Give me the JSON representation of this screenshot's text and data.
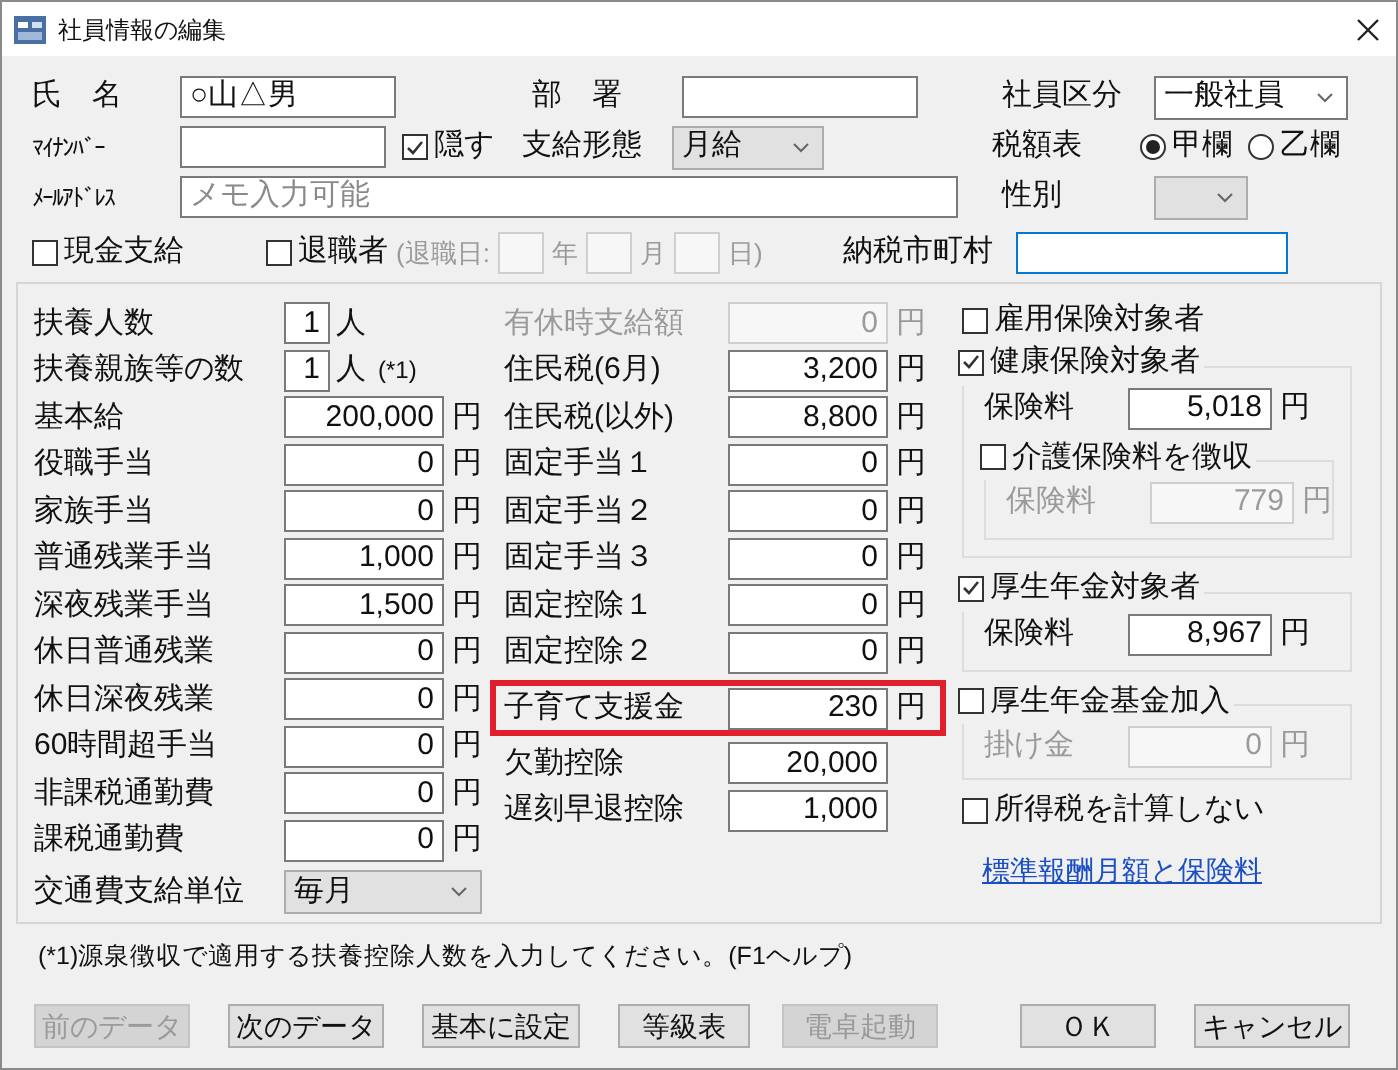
{
  "window": {
    "title": "社員情報の編集"
  },
  "top": {
    "name": {
      "label": "氏　名",
      "value": "○山△男"
    },
    "department": {
      "label": "部　署"
    },
    "employee_type": {
      "label": "社員区分",
      "value": "一般社員",
      "editable": true
    },
    "my_number": {
      "label": "ﾏｲﾅﾝﾊﾞｰ"
    },
    "hide": {
      "label": "隠す",
      "checked": true
    },
    "pay_type": {
      "label": "支給形態",
      "value": "月給",
      "editable": false
    },
    "tax_table": {
      "label": "税額表",
      "options": [
        {
          "label": "甲欄",
          "selected": true
        },
        {
          "label": "乙欄",
          "selected": false
        }
      ]
    },
    "email": {
      "label": "ﾒｰﾙｱﾄﾞﾚｽ",
      "placeholder": "メモ入力可能"
    },
    "gender": {
      "label": "性別",
      "editable": false
    },
    "cash_payment": {
      "label": "現金支給",
      "checked": false
    },
    "retired": {
      "label": "退職者",
      "checked": false
    },
    "retire_date": {
      "open": "(退職日:",
      "year": "年",
      "month": "月",
      "close": "日)"
    },
    "municipality": {
      "label": "納税市町村",
      "focused": true
    }
  },
  "left_rows": [
    {
      "kind": "count",
      "label": "扶養人数",
      "value": "1",
      "unit": "人"
    },
    {
      "kind": "count",
      "label": "扶養親族等の数",
      "value": "1",
      "unit": "人",
      "note": "(*1)"
    },
    {
      "kind": "amount",
      "label": "基本給",
      "value": "200,000",
      "unit": "円"
    },
    {
      "kind": "amount",
      "label": "役職手当",
      "value": "0",
      "unit": "円"
    },
    {
      "kind": "amount",
      "label": "家族手当",
      "value": "0",
      "unit": "円"
    },
    {
      "kind": "amount",
      "label": "普通残業手当",
      "value": "1,000",
      "unit": "円"
    },
    {
      "kind": "amount",
      "label": "深夜残業手当",
      "value": "1,500",
      "unit": "円"
    },
    {
      "kind": "amount",
      "label": "休日普通残業",
      "value": "0",
      "unit": "円"
    },
    {
      "kind": "amount",
      "label": "休日深夜残業",
      "value": "0",
      "unit": "円"
    },
    {
      "kind": "amount",
      "label": "60時間超手当",
      "value": "0",
      "unit": "円"
    },
    {
      "kind": "amount",
      "label": "非課税通勤費",
      "value": "0",
      "unit": "円"
    },
    {
      "kind": "amount",
      "label": "課税通勤費",
      "value": "0",
      "unit": "円"
    },
    {
      "kind": "select",
      "label": "交通費支給単位",
      "value": "毎月"
    }
  ],
  "middle_rows": [
    {
      "label": "有休時支給額",
      "value": "0",
      "unit": "円",
      "disabled": true,
      "highlighted": false
    },
    {
      "label": "住民税(6月)",
      "value": "3,200",
      "unit": "円",
      "disabled": false,
      "highlighted": false
    },
    {
      "label": "住民税(以外)",
      "value": "8,800",
      "unit": "円",
      "disabled": false,
      "highlighted": false
    },
    {
      "label": "固定手当１",
      "value": "0",
      "unit": "円",
      "disabled": false,
      "highlighted": false
    },
    {
      "label": "固定手当２",
      "value": "0",
      "unit": "円",
      "disabled": false,
      "highlighted": false
    },
    {
      "label": "固定手当３",
      "value": "0",
      "unit": "円",
      "disabled": false,
      "highlighted": false
    },
    {
      "label": "固定控除１",
      "value": "0",
      "unit": "円",
      "disabled": false,
      "highlighted": false
    },
    {
      "label": "固定控除２",
      "value": "0",
      "unit": "円",
      "disabled": false,
      "highlighted": false
    },
    {
      "label": "子育て支援金",
      "value": "230",
      "unit": "円",
      "disabled": false,
      "highlighted": true
    },
    {
      "label": "欠勤控除",
      "value": "20,000",
      "disabled": false,
      "highlighted": false
    },
    {
      "label": "遅刻早退控除",
      "value": "1,000",
      "disabled": false,
      "highlighted": false
    }
  ],
  "insurance": {
    "employment": {
      "label": "雇用保険対象者",
      "checked": false
    },
    "health": {
      "label": "健康保険対象者",
      "checked": true,
      "fee_label": "保険料",
      "fee": "5,018",
      "unit": "円",
      "care": {
        "label": "介護保険料を徴収",
        "checked": false,
        "fee_label": "保険料",
        "fee": "779",
        "unit": "円"
      }
    },
    "pension": {
      "label": "厚生年金対象者",
      "checked": true,
      "fee_label": "保険料",
      "fee": "8,967",
      "unit": "円"
    },
    "pension_fund": {
      "label": "厚生年金基金加入",
      "checked": false,
      "fee_label": "掛け金",
      "fee": "0",
      "unit": "円"
    },
    "no_income_tax": {
      "label": "所得税を計算しない",
      "checked": false
    },
    "link": "標準報酬月額と保険料"
  },
  "footnote": "(*1)源泉徴収で適用する扶養控除人数を入力してください。(F1ヘルプ)",
  "buttons": [
    {
      "label": "前のデータ",
      "disabled": true
    },
    {
      "label": "次のデータ",
      "disabled": false
    },
    {
      "label": "基本に設定",
      "disabled": false
    },
    {
      "label": "等級表",
      "disabled": false
    },
    {
      "label": "電卓起動",
      "disabled": true
    },
    {
      "label": "ＯＫ",
      "disabled": false
    },
    {
      "label": "キャンセル",
      "disabled": false
    }
  ]
}
